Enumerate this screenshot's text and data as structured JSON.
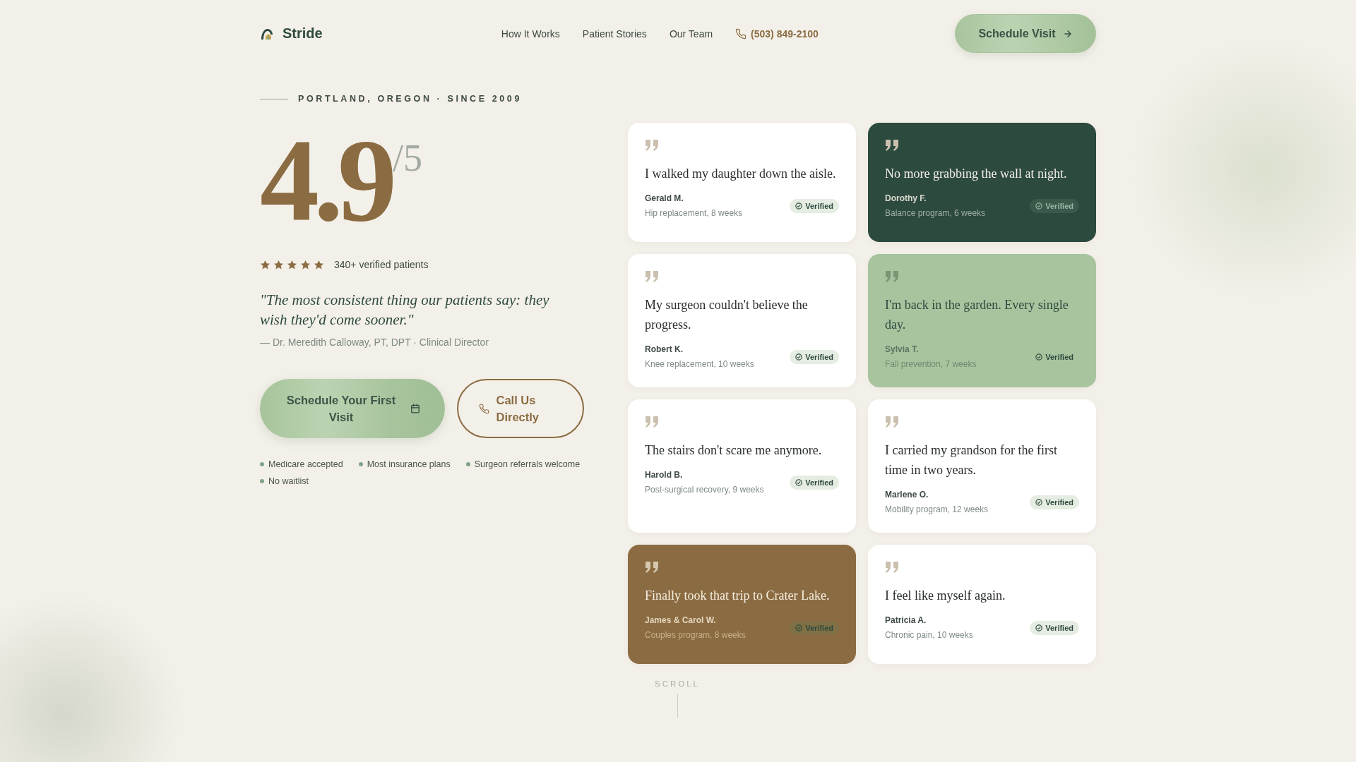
{
  "header": {
    "brand": "Stride",
    "nav": [
      "How It Works",
      "Patient Stories",
      "Our Team"
    ],
    "phone": "(503) 849-2100",
    "cta": "Schedule Visit"
  },
  "hero": {
    "eyebrow": "PORTLAND, OREGON · SINCE 2009",
    "score": "4.9",
    "scale": "/5",
    "stars": 5,
    "rating_note": "340+ verified patients",
    "quote": "\"The most consistent thing our patients say: they wish they'd come sooner.\"",
    "attribution": "— Dr. Meredith Calloway, PT, DPT · Clinical Director",
    "primary_button": "Schedule Your First Visit",
    "secondary_button": "Call Us Directly",
    "perks": [
      "Medicare accepted",
      "Most insurance plans",
      "Surgeon referrals welcome",
      "No waitlist"
    ]
  },
  "testimonials": [
    {
      "kind": "light",
      "quote": "I walked my daughter down the aisle.",
      "name": "Gerald M.",
      "detail": "Hip replacement, 8 weeks",
      "badge": "Verified"
    },
    {
      "kind": "dark",
      "quote": "No more grabbing the wall at night.",
      "name": "Dorothy F.",
      "detail": "Balance program, 6 weeks",
      "badge": "Verified"
    },
    {
      "kind": "light",
      "quote": "My surgeon couldn't believe the progress.",
      "name": "Robert K.",
      "detail": "Knee replacement, 10 weeks",
      "badge": "Verified"
    },
    {
      "kind": "sage",
      "quote": "I'm back in the garden. Every single day.",
      "name": "Sylvia T.",
      "detail": "Fall prevention, 7 weeks",
      "badge": "Verified"
    },
    {
      "kind": "light",
      "quote": "The stairs don't scare me anymore.",
      "name": "Harold B.",
      "detail": "Post-surgical recovery, 9 weeks",
      "badge": "Verified"
    },
    {
      "kind": "light",
      "quote": "I carried my grandson for the first time in two years.",
      "name": "Marlene O.",
      "detail": "Mobility program, 12 weeks",
      "badge": "Verified"
    },
    {
      "kind": "brown",
      "quote": "Finally took that trip to Crater Lake.",
      "name": "James & Carol W.",
      "detail": "Couples program, 8 weeks",
      "badge": "Verified"
    },
    {
      "kind": "light",
      "quote": "I feel like myself again.",
      "name": "Patricia A.",
      "detail": "Chronic pain, 10 weeks",
      "badge": "Verified"
    }
  ],
  "scroll_hint": "SCROLL"
}
